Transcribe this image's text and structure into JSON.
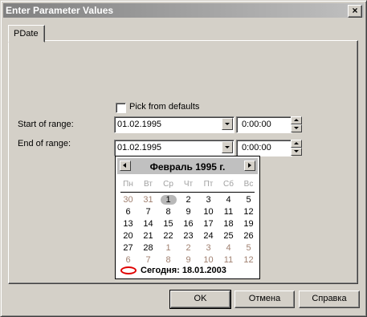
{
  "window": {
    "title": "Enter Parameter Values",
    "close_glyph": "×"
  },
  "tabs": [
    {
      "label": "PDate"
    }
  ],
  "pick_defaults": {
    "label": "Pick from defaults",
    "checked": false
  },
  "start": {
    "label": "Start of range:",
    "date": "01.02.1995",
    "time": "0:00:00"
  },
  "end": {
    "label": "End of range:",
    "date": "01.02.1995",
    "time": "0:00:00"
  },
  "calendar": {
    "month_title": "Февраль 1995 г.",
    "weekdays": [
      "Пн",
      "Вт",
      "Ср",
      "Чт",
      "Пт",
      "Сб",
      "Вс"
    ],
    "weeks": [
      [
        {
          "d": "30",
          "o": true
        },
        {
          "d": "31",
          "o": true
        },
        {
          "d": "1",
          "sel": true
        },
        {
          "d": "2"
        },
        {
          "d": "3"
        },
        {
          "d": "4"
        },
        {
          "d": "5"
        }
      ],
      [
        {
          "d": "6"
        },
        {
          "d": "7"
        },
        {
          "d": "8"
        },
        {
          "d": "9"
        },
        {
          "d": "10"
        },
        {
          "d": "11"
        },
        {
          "d": "12"
        }
      ],
      [
        {
          "d": "13"
        },
        {
          "d": "14"
        },
        {
          "d": "15"
        },
        {
          "d": "16"
        },
        {
          "d": "17"
        },
        {
          "d": "18"
        },
        {
          "d": "19"
        }
      ],
      [
        {
          "d": "20"
        },
        {
          "d": "21"
        },
        {
          "d": "22"
        },
        {
          "d": "23"
        },
        {
          "d": "24"
        },
        {
          "d": "25"
        },
        {
          "d": "26"
        }
      ],
      [
        {
          "d": "27"
        },
        {
          "d": "28"
        },
        {
          "d": "1",
          "o": true
        },
        {
          "d": "2",
          "o": true
        },
        {
          "d": "3",
          "o": true
        },
        {
          "d": "4",
          "o": true
        },
        {
          "d": "5",
          "o": true
        }
      ],
      [
        {
          "d": "6",
          "o": true
        },
        {
          "d": "7",
          "o": true
        },
        {
          "d": "8",
          "o": true
        },
        {
          "d": "9",
          "o": true
        },
        {
          "d": "10",
          "o": true
        },
        {
          "d": "11",
          "o": true
        },
        {
          "d": "12",
          "o": true
        }
      ]
    ],
    "today_label": "Сегодня: 18.01.2003"
  },
  "buttons": {
    "ok": "OK",
    "cancel": "Отмена",
    "help": "Справка"
  }
}
